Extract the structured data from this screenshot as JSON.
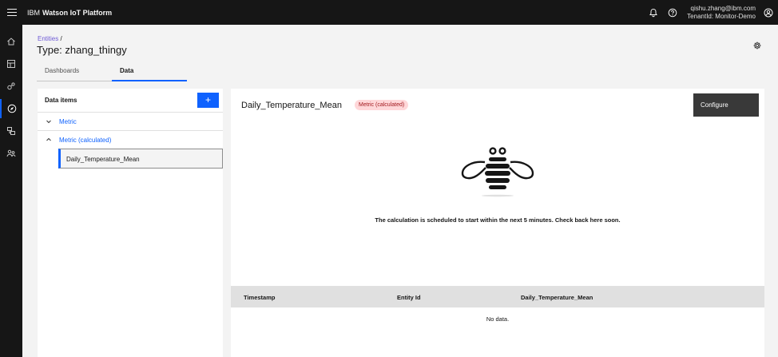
{
  "header": {
    "brand_ibm": "IBM",
    "brand_product": "Watson IoT Platform",
    "user_email": "qishu.zhang@ibm.com",
    "tenant": "TenantId: Monitor-Demo"
  },
  "nav": {
    "icons": [
      "home-icon",
      "dashboard-icon",
      "devices-icon",
      "monitor-icon",
      "data-icon",
      "users-icon"
    ],
    "active_index": 3
  },
  "breadcrumb": {
    "link": "Entities",
    "separator": "/"
  },
  "page_title": "Type: zhang_thingy",
  "tabs": [
    {
      "label": "Dashboards",
      "active": false
    },
    {
      "label": "Data",
      "active": true
    }
  ],
  "data_items": {
    "title": "Data items",
    "add_label": "+",
    "groups": [
      {
        "label": "Metric",
        "expanded": false
      },
      {
        "label": "Metric (calculated)",
        "expanded": true
      }
    ],
    "selected_item": "Daily_Temperature_Mean"
  },
  "detail": {
    "title": "Daily_Temperature_Mean",
    "badge": "Metric (calculated)",
    "configure_label": "Configure",
    "message": "The calculation is scheduled to start within the next 5 minutes. Check back here soon.",
    "table_headers": [
      "Timestamp",
      "Entity Id",
      "Daily_Temperature_Mean"
    ],
    "empty_text": "No data."
  },
  "colors": {
    "accent": "#0f62fe",
    "dark": "#161616",
    "badge_bg": "#ffd7d9",
    "badge_text": "#a2191f"
  }
}
